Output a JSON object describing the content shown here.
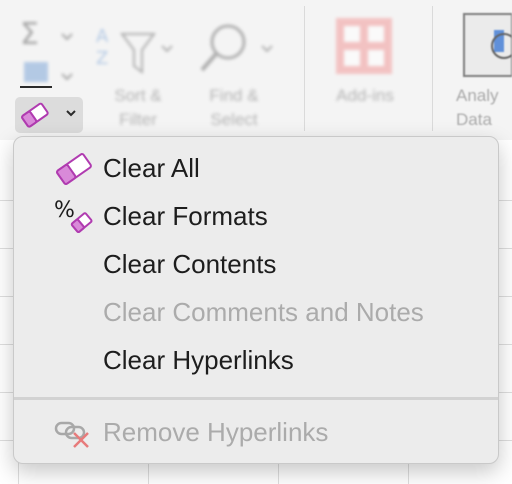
{
  "ribbon": {
    "groups": [
      {
        "label_line1": "Sort &",
        "label_line2": "Filter"
      },
      {
        "label_line1": "Find &",
        "label_line2": "Select"
      },
      {
        "label_line1": "Add-ins",
        "label_line2": ""
      },
      {
        "label_line1": "Analy",
        "label_line2": "Data"
      }
    ],
    "clear_button": {
      "icon": "eraser-icon"
    }
  },
  "menu": {
    "items": [
      {
        "label": "Clear All",
        "icon": "eraser-icon",
        "enabled": true
      },
      {
        "label": "Clear Formats",
        "icon": "clear-formats-icon",
        "enabled": true
      },
      {
        "label": "Clear Contents",
        "enabled": true
      },
      {
        "label": "Clear Comments and Notes",
        "enabled": false
      },
      {
        "label": "Clear Hyperlinks",
        "enabled": true
      },
      {
        "label": "Remove Hyperlinks",
        "icon": "remove-link-icon",
        "enabled": false
      }
    ]
  },
  "colors": {
    "eraser": "#b03bb0",
    "eraser_fill": "#d98ad9",
    "remove_x": "#e77b7b",
    "menu_bg": "#ececec",
    "text": "#1d1d1d",
    "disabled_text": "#ababab"
  }
}
